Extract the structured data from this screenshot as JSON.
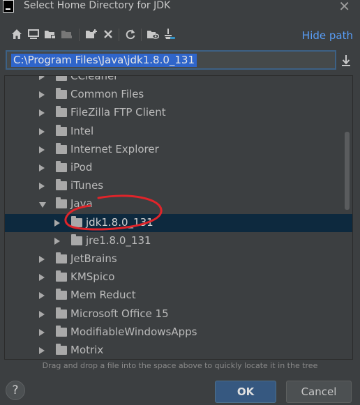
{
  "window": {
    "title": "Select Home Directory for JDK"
  },
  "toolbar": {
    "icons": [
      "home-icon",
      "desktop-icon",
      "project-folder-icon",
      "module-folder-icon",
      "new-folder-icon",
      "delete-icon",
      "refresh-icon",
      "show-hidden-icon",
      "clear-cache-icon"
    ],
    "hide_path_label": "Hide path"
  },
  "path": {
    "value": "C:\\Program Files\\Java\\jdk1.8.0_131"
  },
  "tree": {
    "items": [
      {
        "label": "CCleaner",
        "level": 0,
        "expanded": false,
        "selected": false
      },
      {
        "label": "Common Files",
        "level": 0,
        "expanded": false,
        "selected": false
      },
      {
        "label": "FileZilla FTP Client",
        "level": 0,
        "expanded": false,
        "selected": false
      },
      {
        "label": "Intel",
        "level": 0,
        "expanded": false,
        "selected": false
      },
      {
        "label": "Internet Explorer",
        "level": 0,
        "expanded": false,
        "selected": false
      },
      {
        "label": "iPod",
        "level": 0,
        "expanded": false,
        "selected": false
      },
      {
        "label": "iTunes",
        "level": 0,
        "expanded": false,
        "selected": false
      },
      {
        "label": "Java",
        "level": 0,
        "expanded": true,
        "selected": false
      },
      {
        "label": "jdk1.8.0_131",
        "level": 1,
        "expanded": false,
        "selected": true
      },
      {
        "label": "jre1.8.0_131",
        "level": 1,
        "expanded": false,
        "selected": false
      },
      {
        "label": "JetBrains",
        "level": 0,
        "expanded": false,
        "selected": false
      },
      {
        "label": "KMSpico",
        "level": 0,
        "expanded": false,
        "selected": false
      },
      {
        "label": "Mem Reduct",
        "level": 0,
        "expanded": false,
        "selected": false
      },
      {
        "label": "Microsoft Office 15",
        "level": 0,
        "expanded": false,
        "selected": false
      },
      {
        "label": "ModifiableWindowsApps",
        "level": 0,
        "expanded": false,
        "selected": false
      },
      {
        "label": "Motrix",
        "level": 0,
        "expanded": false,
        "selected": false
      }
    ]
  },
  "hint": "Drag and drop a file into the space above to quickly locate it in the tree",
  "buttons": {
    "help": "?",
    "ok": "OK",
    "cancel": "Cancel"
  },
  "colors": {
    "background": "#3c3f41",
    "selection": "#0d293e",
    "accent": "#589df6",
    "ok_button": "#365880",
    "annotation": "#e0242a"
  }
}
